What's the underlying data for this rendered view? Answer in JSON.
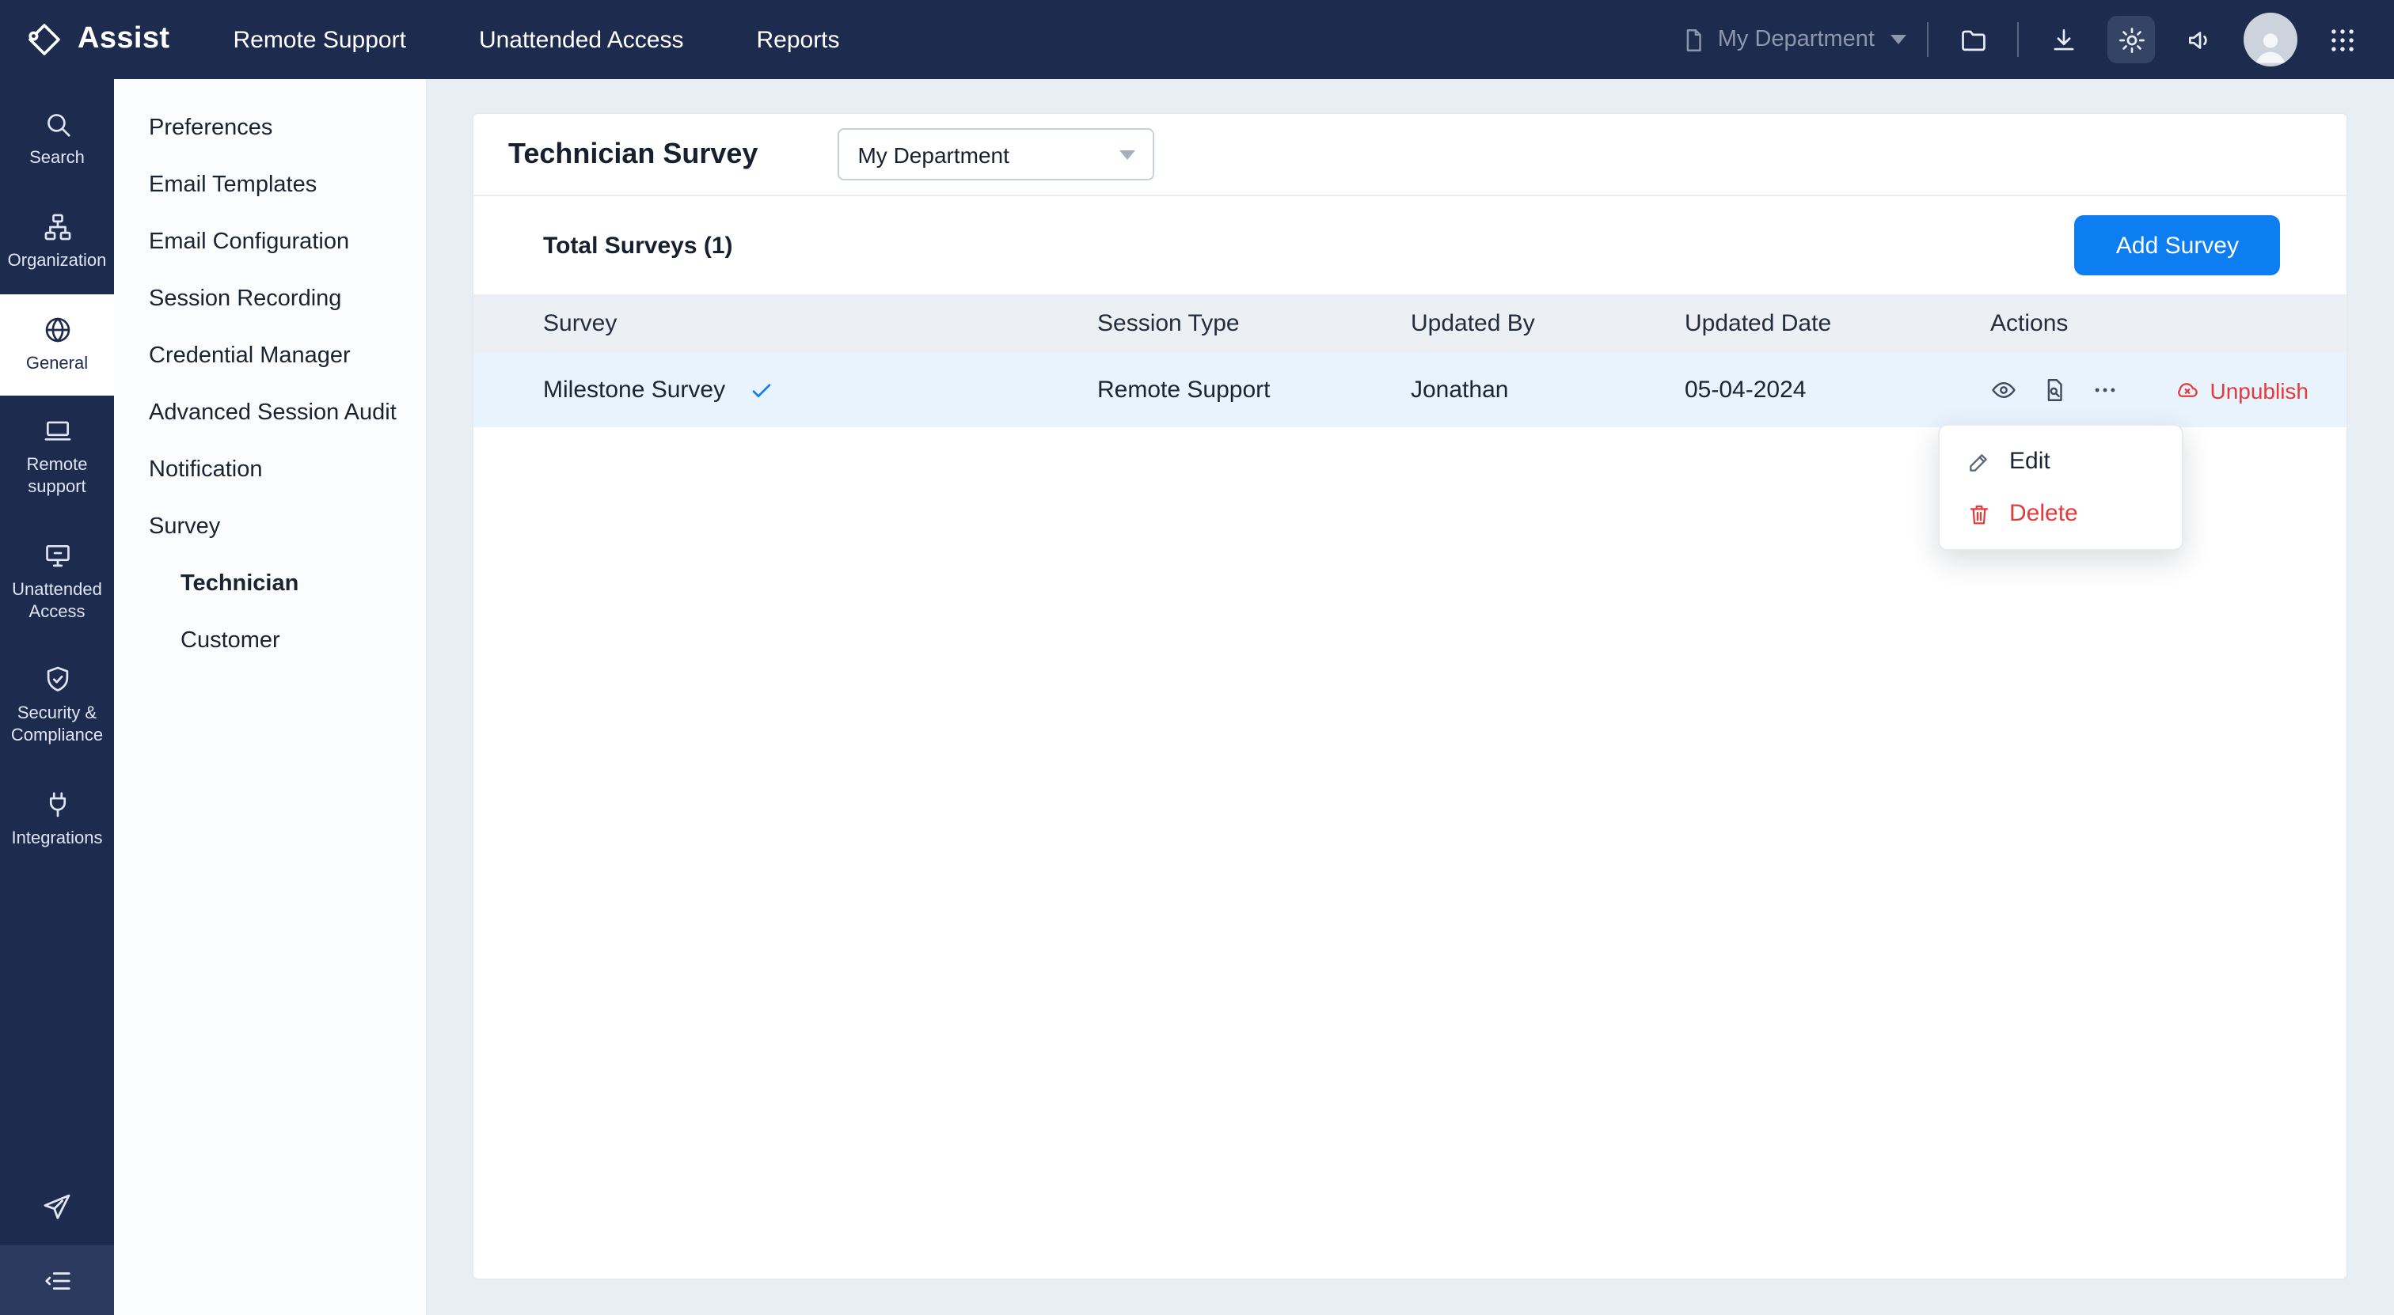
{
  "colors": {
    "navbar": "#1D2B4F",
    "accent_blue": "#0C7EF2",
    "danger_red": "#E23B3B",
    "row_highlight": "#E9F3FE",
    "table_header_bg": "#ECEFF4"
  },
  "topbar": {
    "brand": "Assist",
    "brand_icon": "assist-logo-icon",
    "nav": [
      {
        "label": "Remote Support"
      },
      {
        "label": "Unattended Access"
      },
      {
        "label": "Reports"
      }
    ],
    "department": {
      "icon": "document-icon",
      "label": "My Department",
      "caret": "chevron-down-icon"
    },
    "icons": [
      "folder-icon",
      "download-icon",
      "gear-icon",
      "megaphone-icon",
      "avatar",
      "apps-grid-icon"
    ],
    "active_icon": "gear-icon"
  },
  "rail": {
    "items": [
      {
        "label": "Search",
        "icon": "search-icon",
        "selected": false
      },
      {
        "label": "Organization",
        "icon": "organization-icon",
        "selected": false
      },
      {
        "label": "General",
        "icon": "globe-icon",
        "selected": true
      },
      {
        "label": "Remote support",
        "icon": "remote-support-icon",
        "selected": false
      },
      {
        "label": "Unattended Access",
        "icon": "unattended-access-icon",
        "selected": false
      },
      {
        "label": "Security & Compliance",
        "icon": "security-shield-icon",
        "selected": false
      },
      {
        "label": "Integrations",
        "icon": "integrations-plug-icon",
        "selected": false
      }
    ],
    "bottom_icons": [
      "send-icon",
      "collapse-menu-icon"
    ]
  },
  "sidebar": {
    "items": [
      {
        "label": "Preferences"
      },
      {
        "label": "Email Templates"
      },
      {
        "label": "Email Configuration"
      },
      {
        "label": "Session Recording"
      },
      {
        "label": "Credential Manager"
      },
      {
        "label": "Advanced Session Audit"
      },
      {
        "label": "Notification"
      },
      {
        "label": "Survey"
      }
    ],
    "sub_items": [
      {
        "label": "Technician",
        "selected": true
      },
      {
        "label": "Customer",
        "selected": false
      }
    ]
  },
  "main": {
    "title": "Technician Survey",
    "department_dropdown": {
      "value": "My Department"
    },
    "total_label": "Total Surveys (1)",
    "add_button": "Add Survey",
    "table": {
      "headers": [
        "Survey",
        "Session Type",
        "Updated By",
        "Updated Date",
        "Actions"
      ],
      "rows": [
        {
          "survey": "Milestone Survey",
          "published": true,
          "session_type": "Remote Support",
          "updated_by": "Jonathan",
          "updated_date": "05-04-2024",
          "row_icons": [
            "view-icon",
            "report-icon",
            "more-icon"
          ],
          "unpublish_label": "Unpublish"
        }
      ]
    },
    "context_menu": {
      "items": [
        {
          "label": "Edit",
          "icon": "edit-pencil-icon",
          "danger": false
        },
        {
          "label": "Delete",
          "icon": "delete-trash-icon",
          "danger": true
        }
      ]
    }
  }
}
